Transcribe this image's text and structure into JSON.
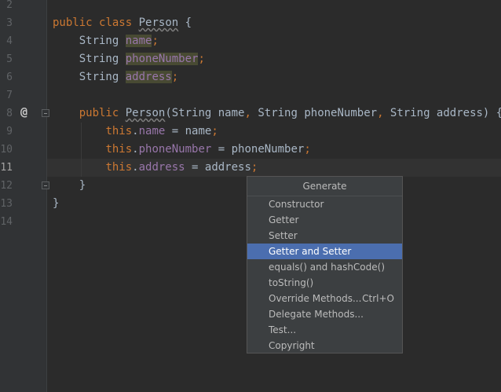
{
  "gutter": {
    "line_numbers": [
      "2",
      "3",
      "4",
      "5",
      "6",
      "7",
      "8",
      "9",
      "10",
      "11",
      "12",
      "13",
      "14"
    ],
    "override_marker": "@"
  },
  "code": {
    "l3": {
      "kw1": "public",
      "kw2": "class",
      "class_name": "Person",
      "brace": " {"
    },
    "l4": {
      "type": "String",
      "field": "name",
      "semi": ";"
    },
    "l5": {
      "type": "String",
      "field": "phoneNumber",
      "semi": ";"
    },
    "l6": {
      "type": "String",
      "field": "address",
      "semi": ";"
    },
    "l8": {
      "kw": "public",
      "ctor": "Person",
      "params_a": "(String name",
      "comma1": ",",
      "params_b": " String phoneNumber",
      "comma2": ",",
      "params_c": " String address) {"
    },
    "l9": {
      "this": "this",
      "dot": ".",
      "field": "name",
      "rest": " = name",
      "semi": ";"
    },
    "l10": {
      "this": "this",
      "dot": ".",
      "field": "phoneNumber",
      "rest": " = phoneNumber",
      "semi": ";"
    },
    "l11": {
      "this": "this",
      "dot": ".",
      "field": "address",
      "rest": " = address",
      "semi": ";"
    },
    "l12": {
      "brace": "}"
    },
    "l13": {
      "brace": "}"
    }
  },
  "popup": {
    "title": "Generate",
    "items": [
      {
        "label": "Constructor",
        "shortcut": ""
      },
      {
        "label": "Getter",
        "shortcut": ""
      },
      {
        "label": "Setter",
        "shortcut": ""
      },
      {
        "label": "Getter and Setter",
        "shortcut": ""
      },
      {
        "label": "equals() and hashCode()",
        "shortcut": ""
      },
      {
        "label": "toString()",
        "shortcut": ""
      },
      {
        "label": "Override Methods...",
        "shortcut": "Ctrl+O"
      },
      {
        "label": "Delegate Methods...",
        "shortcut": ""
      },
      {
        "label": "Test...",
        "shortcut": ""
      },
      {
        "label": "Copyright",
        "shortcut": ""
      }
    ],
    "selected_index": 3
  },
  "colors": {
    "background": "#2b2b2b",
    "keyword": "#cc7832",
    "field": "#9876aa",
    "text": "#a9b7c6",
    "selection": "#4b6eaf"
  }
}
